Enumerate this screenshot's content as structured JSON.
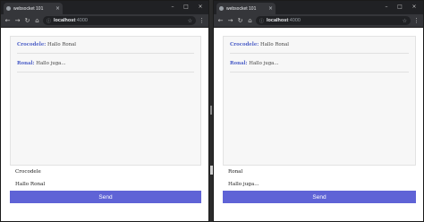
{
  "windows": [
    {
      "tab_title": "websocket 101",
      "url_host": "localhost",
      "url_port": ":4000",
      "messages": [
        {
          "name": "Crocodele:",
          "text": "Hallo Ronal"
        },
        {
          "name": "Ronal:",
          "text": "Hallo juga..."
        }
      ],
      "name_field": "Crocodele",
      "message_field": "Hallo Ronal",
      "send_label": "Send"
    },
    {
      "tab_title": "websocket 101",
      "url_host": "localhost",
      "url_port": ":4000",
      "messages": [
        {
          "name": "Crocodele:",
          "text": "Hallo Ronal"
        },
        {
          "name": "Ronal:",
          "text": "Hallo juga..."
        }
      ],
      "name_field": "Ronal",
      "message_field": "Hallo juga...",
      "send_label": "Send"
    }
  ],
  "icons": {
    "tab_close": "×",
    "minimize": "–",
    "maximize": "□",
    "close": "×",
    "back": "←",
    "forward": "→",
    "reload": "↻",
    "home": "⌂",
    "info": "ⓘ",
    "star": "☆",
    "menu": "⋮"
  },
  "colors": {
    "accent": "#5f63d6",
    "name_color": "#4b5ec7"
  }
}
